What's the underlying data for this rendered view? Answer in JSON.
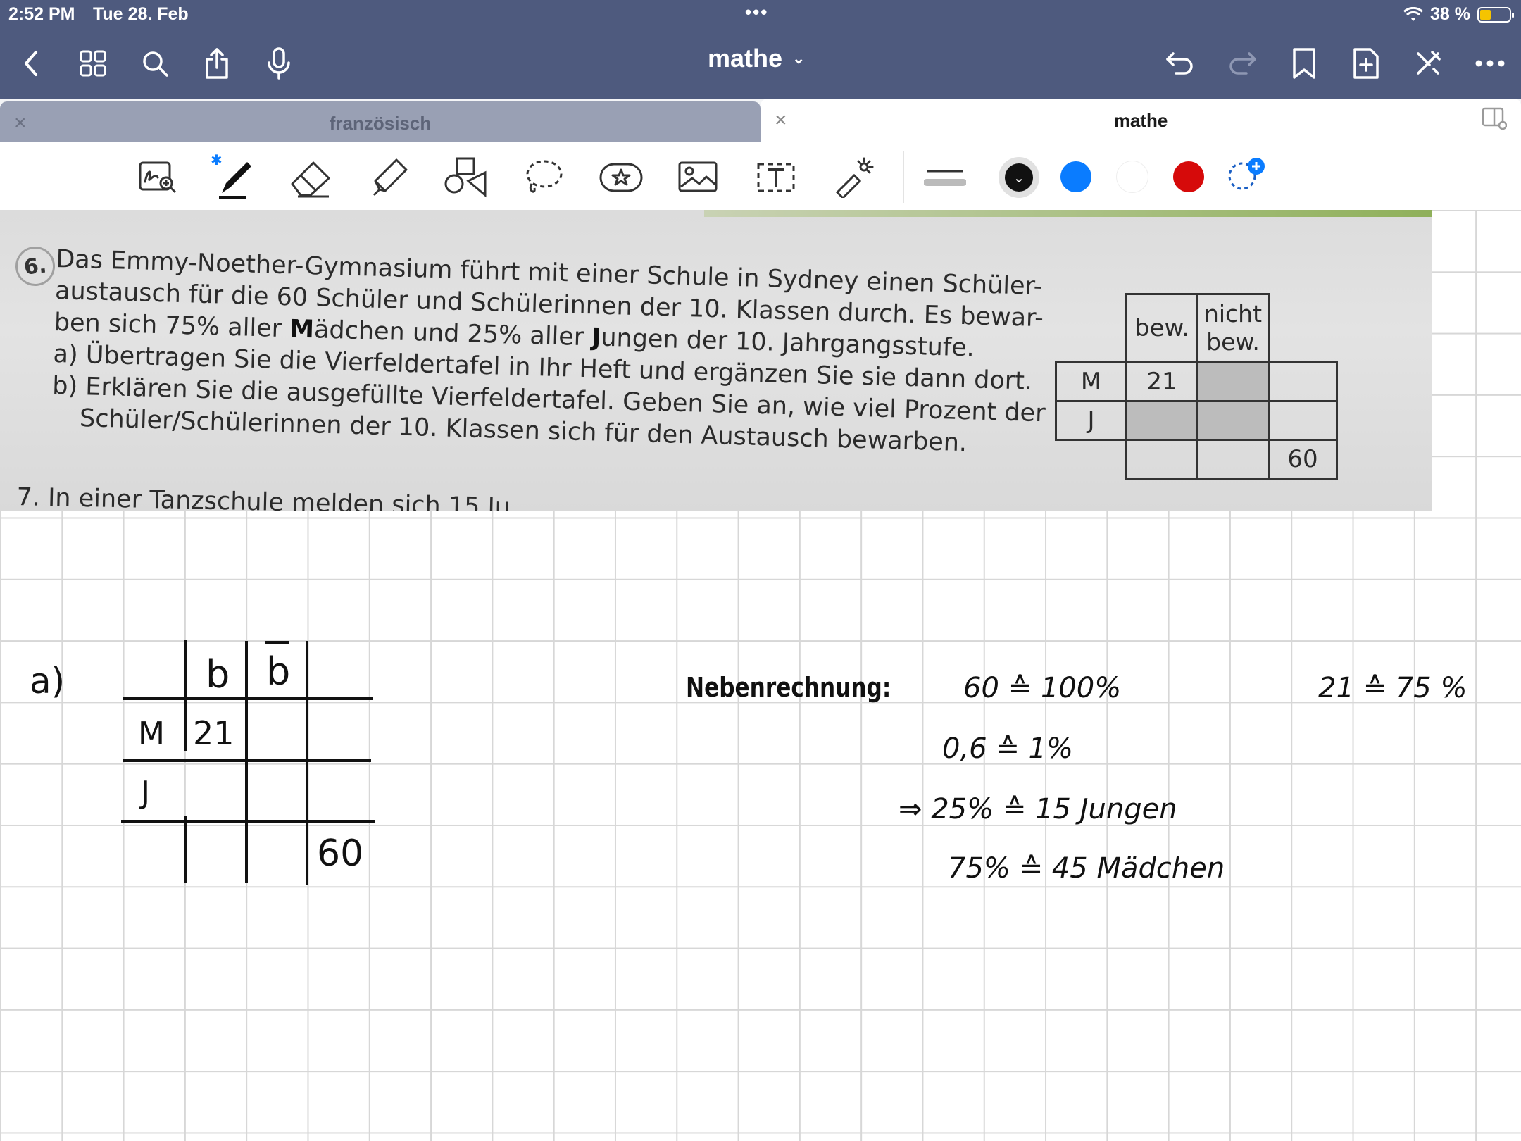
{
  "status_bar": {
    "time": "2:52 PM",
    "date": "Tue 28. Feb",
    "battery": "38 %",
    "battery_level": 0.38
  },
  "nav": {
    "title": "mathe",
    "icons": [
      "back-icon",
      "grid-icon",
      "search-icon",
      "share-icon",
      "microphone-icon",
      "undo-icon",
      "redo-icon",
      "bookmark-icon",
      "add-page-icon",
      "close-toolbar-icon",
      "more-icon"
    ]
  },
  "tabs": [
    {
      "label": "französisch",
      "active": false
    },
    {
      "label": "mathe",
      "active": true
    }
  ],
  "toolbar": {
    "tools": [
      "zoom-window-icon",
      "pen-icon",
      "eraser-icon",
      "highlighter-icon",
      "shapes-icon",
      "lasso-icon",
      "sticker-icon",
      "image-icon",
      "text-icon",
      "laser-pointer-icon"
    ],
    "colors": [
      "#111111",
      "#0a7cff",
      "#ffffff",
      "#d60a0a"
    ]
  },
  "textbook": {
    "task_number": "6.",
    "lines": [
      "Das Emmy-Noether-Gymnasium führt mit einer Schule in Sydney einen Schüler-",
      "austausch für die 60 Schüler und Schülerinnen der 10. Klassen durch. Es bewar-",
      "ben sich 75% aller Mädchen und 25% aller Jungen der 10. Jahrgangsstufe.",
      "a) Übertragen Sie die Vierfeldertafel in Ihr Heft und ergänzen Sie sie dann dort.",
      "b) Erklären Sie die ausgefüllte Vierfeldertafel. Geben Sie an, wie viel Prozent der",
      "Schüler/Schülerinnen der 10. Klassen sich für den Austausch bewarben."
    ],
    "next_task": "7. In einer Tanzschule melden sich 15 Ju",
    "table": {
      "col_headers": [
        "bew.",
        "nicht bew."
      ],
      "row_headers": [
        "M",
        "J"
      ],
      "cell_m_bew": "21",
      "total": "60"
    }
  },
  "notes": {
    "part_label": "a)",
    "table": {
      "col_b": "b",
      "col_not_b": "b",
      "row_m": "M",
      "row_j": "J",
      "cell_m_b": "21",
      "total": "60"
    },
    "nebenrechnung_label": "Nebenrechnung:",
    "lines": [
      "60 ≙ 100%",
      "0,6 ≙ 1%",
      "⇒ 25% ≙ 15 Jungen",
      "75% ≙ 45 Mädchen"
    ],
    "side_note": "21 ≙ 75 %"
  }
}
